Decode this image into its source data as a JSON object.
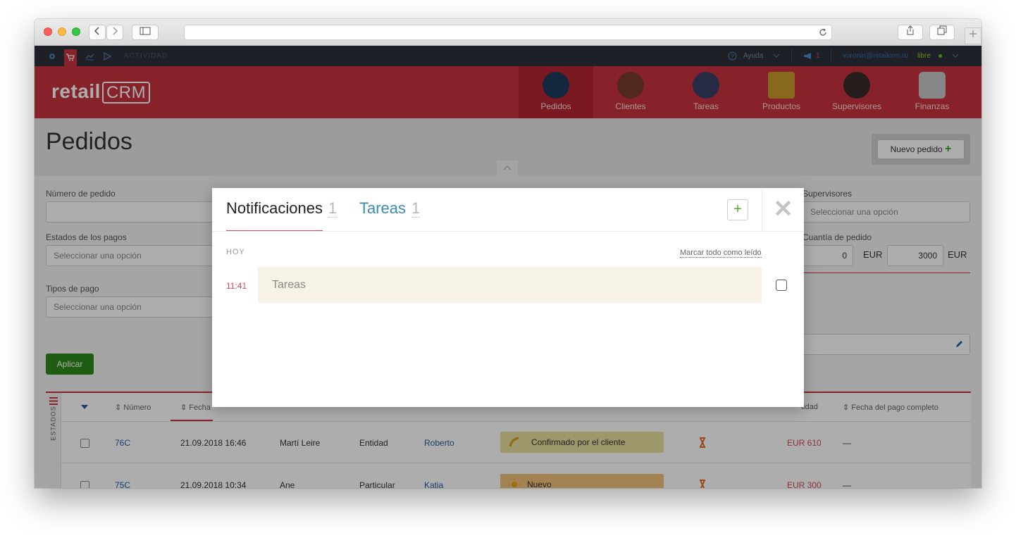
{
  "topbar": {
    "activity": "ACTIVIDAD",
    "help": "Ayuda",
    "alerts_count": "1",
    "user_email": "voronin@retailcrm.ru",
    "user_status": "libre"
  },
  "brand": {
    "logo_text": "retail",
    "logo_crm": "CRM"
  },
  "nav": [
    {
      "label": "Pedidos",
      "icon": "cart-icon"
    },
    {
      "label": "Clientes",
      "icon": "client-icon"
    },
    {
      "label": "Tareas",
      "icon": "tasks-icon"
    },
    {
      "label": "Productos",
      "icon": "box-icon"
    },
    {
      "label": "Supervisores",
      "icon": "supervisor-icon"
    },
    {
      "label": "Finanzas",
      "icon": "finance-icon"
    }
  ],
  "page": {
    "title": "Pedidos",
    "new_order": "Nuevo pedido",
    "new_order_plus": "+"
  },
  "filters": {
    "order_number": "Número de pedido",
    "payment_states": "Estados de los pagos",
    "payment_states_placeholder": "Seleccionar una opción",
    "payment_types": "Tipos de pago",
    "payment_types_placeholder": "Seleccionar una opción",
    "supervisors": "Supervisores",
    "supervisors_placeholder": "Seleccionar una opción",
    "order_amount": "Cuantía de pedido",
    "amount_from": "0",
    "amount_to": "3000",
    "currency": "EUR",
    "apply": "Aplicar"
  },
  "table": {
    "side_label": "ESTADOS",
    "headers": {
      "number": "Número",
      "date": "Fecha",
      "quantity": "tidad",
      "paid_date": "Fecha del pago completo"
    },
    "rows": [
      {
        "number": "76C",
        "date": "21.09.2018 16:46",
        "client": "Martí Leire",
        "type": "Entidad",
        "manager": "Roberto",
        "status": "Confirmado por el cliente",
        "amount": "EUR 610",
        "paid": "—"
      },
      {
        "number": "75C",
        "date": "21.09.2018 10:34",
        "client": "Ane",
        "type": "Particular",
        "manager": "Katia",
        "status": "Nuevo",
        "amount": "EUR 300",
        "paid": "—"
      }
    ]
  },
  "modal": {
    "tab_notifications": "Notificaciones",
    "notifications_count": "1",
    "tab_tasks": "Tareas",
    "tasks_count": "1",
    "add": "+",
    "close": "✕",
    "group_label": "HOY",
    "mark_all_read": "Marcar todo como leído",
    "item_time": "11:41",
    "item_text": "Tareas"
  },
  "colors": {
    "brand_red": "#c8313e",
    "tasks_blue": "#3a8bb9",
    "green": "#2e8a1c"
  }
}
